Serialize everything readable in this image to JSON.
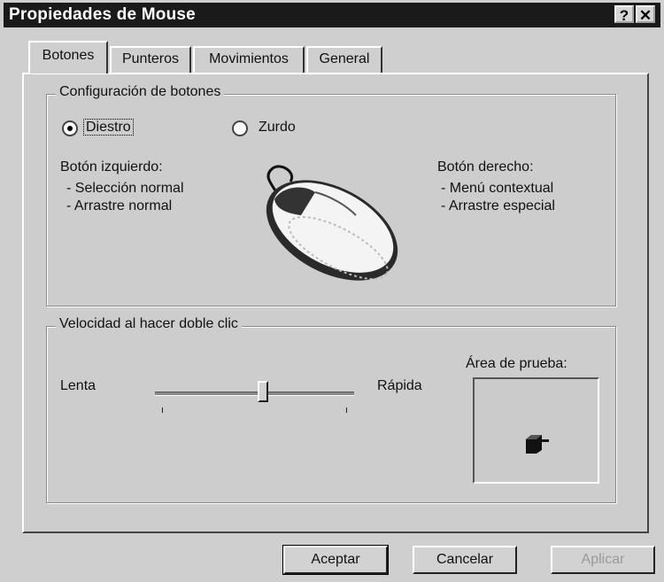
{
  "window": {
    "title": "Propiedades de Mouse",
    "help_label": "?",
    "close_label": "✕"
  },
  "tabs": [
    {
      "label": "Botones",
      "active": true
    },
    {
      "label": "Punteros",
      "active": false
    },
    {
      "label": "Movimientos",
      "active": false
    },
    {
      "label": "General",
      "active": false
    }
  ],
  "button_config": {
    "title": "Configuración de botones",
    "options": [
      {
        "label": "Diestro",
        "selected": true
      },
      {
        "label": "Zurdo",
        "selected": false
      }
    ],
    "left_button": {
      "heading": "Botón izquierdo:",
      "items": [
        "- Selección normal",
        "- Arrastre normal"
      ]
    },
    "right_button": {
      "heading": "Botón derecho:",
      "items": [
        "- Menú contextual",
        "- Arrastre especial"
      ]
    },
    "illustration_icon": "mouse-icon"
  },
  "double_click": {
    "title": "Velocidad al hacer doble clic",
    "slow_label": "Lenta",
    "fast_label": "Rápida",
    "slider_position": 0.55,
    "test_area_label": "Área de prueba:",
    "test_icon": "jack-in-the-box-icon"
  },
  "footer": {
    "ok": "Aceptar",
    "cancel": "Cancelar",
    "apply": "Aplicar"
  }
}
